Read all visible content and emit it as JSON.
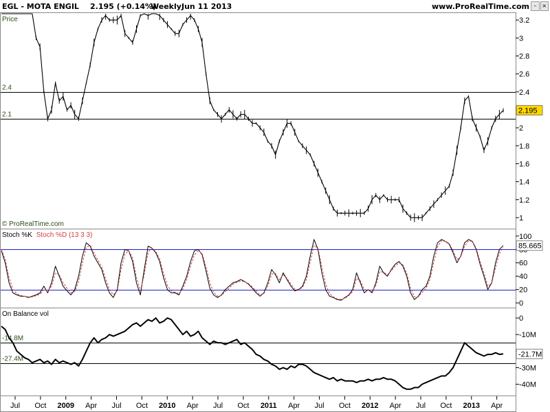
{
  "header": {
    "ticker": "EGL - MOTA ENGIL",
    "price_change": "2.195 (+0.14%)",
    "period": "Weekly",
    "date": "Jun 11 2013",
    "site": "www.ProRealTime.com"
  },
  "watermark": "© ProRealTime.com",
  "colors": {
    "price_bar": "#000000",
    "stoch_k": "#000000",
    "stoch_d": "#d04040",
    "stoch_levels": "#2020c0",
    "obv": "#000000",
    "last_price_bg": "#ffd700",
    "level_label": "#2d4a1a"
  },
  "chart_data": [
    {
      "type": "line",
      "title": "EGL - MOTA ENGIL",
      "ylabel": "Price",
      "y_ticks": [
        "1",
        "1.2",
        "1.4",
        "1.6",
        "1.8",
        "2",
        "2.2",
        "2.4",
        "2.6",
        "2.8",
        "3",
        "3.2"
      ],
      "ylim": [
        0.9,
        3.27
      ],
      "horizontal_levels": [
        {
          "label": "2.4",
          "value": 2.4
        },
        {
          "label": "2.1",
          "value": 2.1
        }
      ],
      "last_value_label": "2.195",
      "last_value": 2.195,
      "x_ticks": [
        "Jul",
        "Oct",
        "2009",
        "Apr",
        "Jul",
        "Oct",
        "2010",
        "Apr",
        "Jul",
        "Oct",
        "2011",
        "Apr",
        "Jul",
        "Oct",
        "2012",
        "Apr",
        "Jul",
        "Oct",
        "2013",
        "Apr"
      ],
      "x": [
        0,
        2,
        4,
        6,
        8,
        10,
        12,
        14,
        16,
        18,
        20,
        22,
        24,
        26,
        28,
        30,
        32,
        34,
        36,
        38,
        40,
        42,
        44,
        46,
        48,
        50,
        52,
        54,
        56,
        58,
        60,
        62,
        64,
        66,
        68,
        70,
        72,
        74,
        76,
        78,
        80,
        82,
        84,
        86,
        88,
        90,
        92,
        94,
        96,
        98,
        100,
        102,
        104,
        106,
        108,
        110,
        112,
        114,
        116,
        118,
        120,
        122,
        124,
        126,
        128,
        130,
        132,
        134,
        136,
        138,
        140,
        142,
        144,
        146,
        148,
        150,
        152,
        154,
        156,
        158,
        160,
        162,
        164,
        166,
        168,
        170,
        172,
        174,
        176,
        178,
        180,
        182,
        184,
        186,
        188,
        190,
        192,
        194,
        196,
        198,
        200,
        202,
        204,
        206,
        208,
        210,
        212,
        214,
        216,
        218,
        220,
        222,
        224,
        226,
        228,
        230,
        232,
        234,
        236,
        238,
        240,
        242,
        244,
        246,
        248,
        250,
        252,
        254,
        256,
        258,
        260
      ],
      "series": [
        {
          "values": [
            3.4,
            3.4,
            3.45,
            3.4,
            3.45,
            3.4,
            3.38,
            3.4,
            3.3,
            3.0,
            2.9,
            2.4,
            2.1,
            2.2,
            2.5,
            2.3,
            2.35,
            2.2,
            2.25,
            2.15,
            2.1,
            2.3,
            2.5,
            2.7,
            2.95,
            3.1,
            3.2,
            3.25,
            3.2,
            3.2,
            3.2,
            3.25,
            3.05,
            3.0,
            2.95,
            3.1,
            3.25,
            3.3,
            3.25,
            3.35,
            3.3,
            3.25,
            3.2,
            3.15,
            3.1,
            3.05,
            3.05,
            3.15,
            3.2,
            3.25,
            3.2,
            3.1,
            2.95,
            2.6,
            2.3,
            2.2,
            2.15,
            2.1,
            2.15,
            2.2,
            2.15,
            2.1,
            2.15,
            2.15,
            2.1,
            2.05,
            2.05,
            2.0,
            1.95,
            1.85,
            1.8,
            1.7,
            1.85,
            1.95,
            2.05,
            2.05,
            1.95,
            1.85,
            1.8,
            1.75,
            1.7,
            1.6,
            1.5,
            1.4,
            1.3,
            1.2,
            1.1,
            1.05,
            1.05,
            1.05,
            1.05,
            1.05,
            1.05,
            1.05,
            1.05,
            1.1,
            1.2,
            1.25,
            1.2,
            1.25,
            1.2,
            1.2,
            1.2,
            1.2,
            1.1,
            1.05,
            1.0,
            1.0,
            1.0,
            1.0,
            1.05,
            1.1,
            1.15,
            1.2,
            1.25,
            1.3,
            1.35,
            1.5,
            1.75,
            2.0,
            2.3,
            2.35,
            2.1,
            2.0,
            1.9,
            1.75,
            1.85,
            2.0,
            2.1,
            2.15,
            2.195
          ]
        }
      ]
    },
    {
      "type": "line",
      "title": "Stoch %K Stoch %D (13 3 3)",
      "y_ticks": [
        "0",
        "20",
        "40",
        "60",
        "80",
        "100"
      ],
      "ylim": [
        -5,
        108
      ],
      "horizontal_levels": [
        {
          "value": 80
        },
        {
          "value": 20
        }
      ],
      "last_value_label": "85.665",
      "last_value": 85.665,
      "x": [
        0,
        2,
        4,
        6,
        8,
        10,
        12,
        14,
        16,
        18,
        20,
        22,
        24,
        26,
        28,
        30,
        32,
        34,
        36,
        38,
        40,
        42,
        44,
        46,
        48,
        50,
        52,
        54,
        56,
        58,
        60,
        62,
        64,
        66,
        68,
        70,
        72,
        74,
        76,
        78,
        80,
        82,
        84,
        86,
        88,
        90,
        92,
        94,
        96,
        98,
        100,
        102,
        104,
        106,
        108,
        110,
        112,
        114,
        116,
        118,
        120,
        122,
        124,
        126,
        128,
        130,
        132,
        134,
        136,
        138,
        140,
        142,
        144,
        146,
        148,
        150,
        152,
        154,
        156,
        158,
        160,
        162,
        164,
        166,
        168,
        170,
        172,
        174,
        176,
        178,
        180,
        182,
        184,
        186,
        188,
        190,
        192,
        194,
        196,
        198,
        200,
        202,
        204,
        206,
        208,
        210,
        212,
        214,
        216,
        218,
        220,
        222,
        224,
        226,
        228,
        230,
        232,
        234,
        236,
        238,
        240,
        242,
        244,
        246,
        248,
        250,
        252,
        254,
        256,
        258,
        260
      ],
      "series": [
        {
          "name": "Stoch %K",
          "values": [
            78,
            60,
            30,
            15,
            12,
            10,
            10,
            8,
            10,
            12,
            15,
            25,
            15,
            30,
            55,
            40,
            25,
            18,
            12,
            20,
            40,
            70,
            90,
            85,
            70,
            60,
            50,
            30,
            15,
            8,
            20,
            60,
            80,
            78,
            62,
            30,
            12,
            50,
            85,
            82,
            75,
            62,
            38,
            20,
            15,
            15,
            12,
            25,
            40,
            62,
            78,
            80,
            72,
            48,
            22,
            12,
            8,
            12,
            20,
            25,
            30,
            32,
            35,
            32,
            28,
            22,
            15,
            10,
            15,
            30,
            50,
            42,
            30,
            45,
            35,
            25,
            18,
            20,
            25,
            40,
            70,
            95,
            80,
            45,
            20,
            10,
            8,
            5,
            4,
            8,
            12,
            20,
            45,
            30,
            15,
            20,
            15,
            30,
            55,
            45,
            40,
            50,
            58,
            62,
            55,
            40,
            15,
            5,
            10,
            20,
            25,
            40,
            70,
            90,
            95,
            92,
            88,
            75,
            60,
            70,
            90,
            95,
            92,
            80,
            58,
            40,
            20,
            30,
            60,
            80,
            85.665
          ]
        },
        {
          "name": "Stoch %D",
          "values": [
            80,
            65,
            38,
            20,
            14,
            11,
            10,
            9,
            9,
            11,
            13,
            20,
            18,
            25,
            45,
            42,
            30,
            22,
            15,
            17,
            32,
            60,
            83,
            86,
            75,
            64,
            54,
            36,
            20,
            12,
            18,
            50,
            73,
            78,
            67,
            38,
            18,
            42,
            76,
            82,
            77,
            66,
            44,
            26,
            18,
            16,
            14,
            21,
            35,
            55,
            72,
            78,
            74,
            54,
            30,
            16,
            10,
            11,
            17,
            22,
            28,
            31,
            33,
            32,
            29,
            24,
            18,
            12,
            14,
            25,
            43,
            44,
            35,
            42,
            37,
            28,
            21,
            20,
            23,
            35,
            61,
            86,
            82,
            54,
            28,
            14,
            9,
            6,
            5,
            7,
            11,
            17,
            37,
            33,
            20,
            19,
            17,
            26,
            47,
            46,
            42,
            48,
            55,
            60,
            57,
            44,
            22,
            9,
            9,
            16,
            22,
            35,
            61,
            84,
            93,
            92,
            89,
            78,
            65,
            69,
            85,
            93,
            92,
            82,
            62,
            45,
            25,
            29,
            53,
            74,
            83
          ]
        }
      ]
    },
    {
      "type": "line",
      "title": "On Balance vol",
      "y_ticks": [
        "0",
        "-10M",
        "-20M",
        "-30M",
        "-40M"
      ],
      "ylim": [
        -46,
        5
      ],
      "horizontal_levels": [
        {
          "label": "-14.8M",
          "value": -14.8
        },
        {
          "label": "-27.4M",
          "value": -27.4
        }
      ],
      "last_value_label": "-21.7M",
      "last_value": -21.7,
      "x": [
        0,
        2,
        4,
        6,
        8,
        10,
        12,
        14,
        16,
        18,
        20,
        22,
        24,
        26,
        28,
        30,
        32,
        34,
        36,
        38,
        40,
        42,
        44,
        46,
        48,
        50,
        52,
        54,
        56,
        58,
        60,
        62,
        64,
        66,
        68,
        70,
        72,
        74,
        76,
        78,
        80,
        82,
        84,
        86,
        88,
        90,
        92,
        94,
        96,
        98,
        100,
        102,
        104,
        106,
        108,
        110,
        112,
        114,
        116,
        118,
        120,
        122,
        124,
        126,
        128,
        130,
        132,
        134,
        136,
        138,
        140,
        142,
        144,
        146,
        148,
        150,
        152,
        154,
        156,
        158,
        160,
        162,
        164,
        166,
        168,
        170,
        172,
        174,
        176,
        178,
        180,
        182,
        184,
        186,
        188,
        190,
        192,
        194,
        196,
        198,
        200,
        202,
        204,
        206,
        208,
        210,
        212,
        214,
        216,
        218,
        220,
        222,
        224,
        226,
        228,
        230,
        232,
        234,
        236,
        238,
        240,
        242,
        244,
        246,
        248,
        250,
        252,
        254,
        256,
        258,
        260
      ],
      "series": [
        {
          "name": "On Balance vol",
          "values": [
            -5,
            -7,
            -12,
            -15,
            -20,
            -22,
            -24,
            -25,
            -27,
            -26,
            -25,
            -27,
            -26,
            -28,
            -25,
            -27,
            -26,
            -27,
            -28,
            -27,
            -29,
            -25,
            -20,
            -15,
            -12,
            -15,
            -13,
            -12,
            -10,
            -11,
            -10,
            -9,
            -8,
            -6,
            -4,
            -3,
            -5,
            -3,
            -1,
            -2,
            0,
            -3,
            -2,
            0,
            -1,
            -4,
            -7,
            -10,
            -8,
            -11,
            -10,
            -8,
            -12,
            -14,
            -16,
            -14,
            -15,
            -15,
            -16,
            -15,
            -14,
            -13,
            -16,
            -15,
            -17,
            -19,
            -22,
            -23,
            -25,
            -26,
            -28,
            -29,
            -31,
            -30,
            -31,
            -29,
            -30,
            -28,
            -28,
            -29,
            -31,
            -33,
            -34,
            -35,
            -36,
            -37,
            -36,
            -38,
            -37,
            -38,
            -38,
            -38,
            -39,
            -38,
            -38,
            -37,
            -38,
            -37,
            -37,
            -36,
            -37,
            -37,
            -38,
            -40,
            -42,
            -43,
            -43,
            -42,
            -42,
            -40,
            -39,
            -38,
            -37,
            -36,
            -35,
            -35,
            -33,
            -30,
            -25,
            -20,
            -15,
            -17,
            -19,
            -21,
            -22,
            -23,
            -22,
            -22,
            -21,
            -22,
            -21.7
          ]
        }
      ]
    }
  ]
}
